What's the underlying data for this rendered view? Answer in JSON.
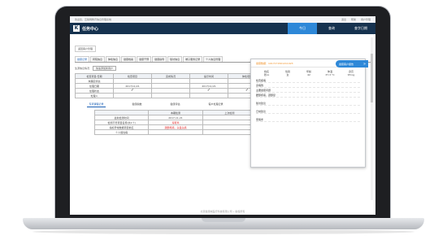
{
  "topbar": {
    "left_text": "欢迎您，互联网教育信息管理系统",
    "links": [
      "退出",
      "帮助",
      "用户管理"
    ]
  },
  "header": {
    "logo_mark": "K",
    "logo_text": "任务中心",
    "nav": [
      {
        "label": "今日",
        "active": true
      },
      {
        "label": "查询",
        "active": false
      },
      {
        "label": "查字日期",
        "active": false
      }
    ]
  },
  "breadcrumb": "返回客户管理",
  "tabs": [
    {
      "label": "健康记录",
      "active": true
    },
    {
      "label": "转院信息",
      "active": false
    },
    {
      "label": "体检信息",
      "active": false
    },
    {
      "label": "健康档案",
      "active": false
    },
    {
      "label": "健康干预",
      "active": false
    },
    {
      "label": "健康指导",
      "active": false
    },
    {
      "label": "随访信息",
      "active": false
    },
    {
      "label": "端子服务记录",
      "active": false
    },
    {
      "label": "个人信息管理",
      "active": false
    }
  ],
  "filter": {
    "label": "生源信息情况",
    "button": "快速添加新用户"
  },
  "grid1": {
    "headers": [
      "检查项目/日期",
      "检查项目",
      "完成情况",
      "提示时间",
      "体检项目",
      "结束时间",
      "检查时间"
    ],
    "rows": [
      [
        "未确定状态",
        "",
        "",
        "",
        "",
        "",
        ""
      ],
      [
        "处理日期",
        "2017/11/21",
        "",
        "2017/11/21",
        "",
        "",
        "2017/11/21"
      ],
      [
        "处理状态",
        "check",
        "",
        "check",
        "check",
        "check",
        "check"
      ],
      [
        "处理人",
        "",
        "",
        "",
        "",
        "",
        ""
      ]
    ]
  },
  "subtabs": [
    {
      "label": "专项课程记录",
      "active": true
    },
    {
      "label": "健康指数",
      "active": false
    },
    {
      "label": "健康评估",
      "active": false
    },
    {
      "label": "客户处理记录",
      "active": false
    }
  ],
  "grid2": {
    "headers": [
      "",
      "本期检测",
      "上次检测"
    ],
    "rows": [
      {
        "label": "最新检测时间",
        "a": "2017-11-21",
        "b": "",
        "red": false
      },
      {
        "label": "检测不符项目名称(共1个)",
        "a": "海有鸡",
        "b": "",
        "red": true
      },
      {
        "label": "指标异常数据项目前五",
        "a": "颈部疼痛，头晕头痛",
        "b": "",
        "red": true
      },
      {
        "label": "个人慢性病",
        "a": "",
        "b": "",
        "red": false
      }
    ]
  },
  "footer": "北京健康城医疗科技有限公司 • 版权所有",
  "panel": {
    "title": "健康数据：1017171501211023",
    "button": "健康客户报告",
    "table_headers": [
      "姓名",
      "性别",
      "年龄",
      "体温",
      "身高"
    ],
    "table_values": [
      "张xx",
      "女",
      "42",
      "37.3 °C",
      "65 kg"
    ],
    "items": [
      "检查疾病",
      "身病残",
      "主要健康问题",
      "腰部疼痛，颈部复",
      "随访建议",
      "日常建议",
      "家族史"
    ]
  },
  "colors": {
    "header_bg": "#16324f",
    "accent": "#2e88d8",
    "alert_red": "#e02020",
    "panel_title": "#f08c1e"
  }
}
